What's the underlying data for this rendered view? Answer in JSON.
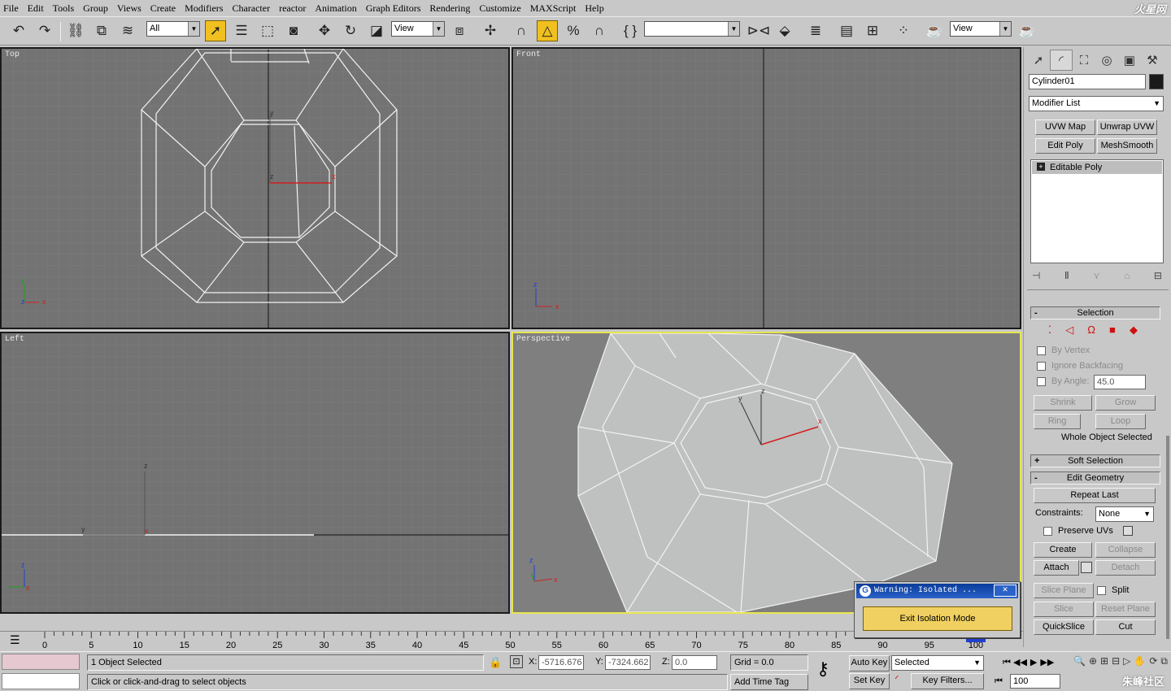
{
  "menu": [
    "File",
    "Edit",
    "Tools",
    "Group",
    "Views",
    "Create",
    "Modifiers",
    "Character",
    "reactor",
    "Animation",
    "Graph Editors",
    "Rendering",
    "Customize",
    "MAXScript",
    "Help"
  ],
  "logo": "火星网",
  "toolbar": {
    "filter_value": "All",
    "ref_coord": "View",
    "named_selection": "",
    "view_dropdown": "View"
  },
  "viewports": {
    "top": "Top",
    "front": "Front",
    "left": "Left",
    "perspective": "Perspective"
  },
  "command_panel": {
    "object_name": "Cylinder01",
    "object_color": "#1a1a1a",
    "modifier_list": "Modifier List",
    "buttons": [
      "UVW Map",
      "Unwrap UVW",
      "Edit Poly",
      "MeshSmooth"
    ],
    "stack_item": "Editable Poly",
    "selection": {
      "header": "Selection",
      "by_vertex": "By Vertex",
      "ignore_backfacing": "Ignore Backfacing",
      "by_angle": "By Angle:",
      "by_angle_value": "45.0",
      "shrink": "Shrink",
      "grow": "Grow",
      "ring": "Ring",
      "loop": "Loop",
      "status": "Whole Object Selected"
    },
    "soft_selection": "Soft Selection",
    "edit_geometry": {
      "header": "Edit Geometry",
      "repeat_last": "Repeat Last",
      "constraints_label": "Constraints:",
      "constraints_value": "None",
      "preserve_uvs": "Preserve UVs",
      "create": "Create",
      "collapse": "Collapse",
      "attach": "Attach",
      "detach": "Detach",
      "slice_plane": "Slice Plane",
      "split": "Split",
      "slice": "Slice",
      "reset_plane": "Reset Plane",
      "quickslice": "QuickSlice",
      "cut": "Cut"
    }
  },
  "timeline": {
    "frame_labels": [
      "0",
      "5",
      "10",
      "15",
      "20",
      "25",
      "30",
      "35",
      "40",
      "45",
      "50",
      "55",
      "60",
      "65",
      "70",
      "75",
      "80",
      "85",
      "90",
      "95",
      "100"
    ]
  },
  "status": {
    "selected_count": "1 Object Selected",
    "prompt": "Click or click-and-drag to select objects",
    "x_label": "X:",
    "x_value": "-5716.676",
    "y_label": "Y:",
    "y_value": "-7324.662",
    "z_label": "Z:",
    "z_value": "0.0",
    "grid": "Grid = 0.0",
    "add_time_tag": "Add Time Tag",
    "auto_key": "Auto Key",
    "set_key": "Set Key",
    "key_mode": "Selected",
    "key_filters": "Key Filters...",
    "frame_value": "100"
  },
  "dialog": {
    "title": "Warning: Isolated ...",
    "button": "Exit Isolation Mode"
  },
  "watermark": "朱峰社区"
}
